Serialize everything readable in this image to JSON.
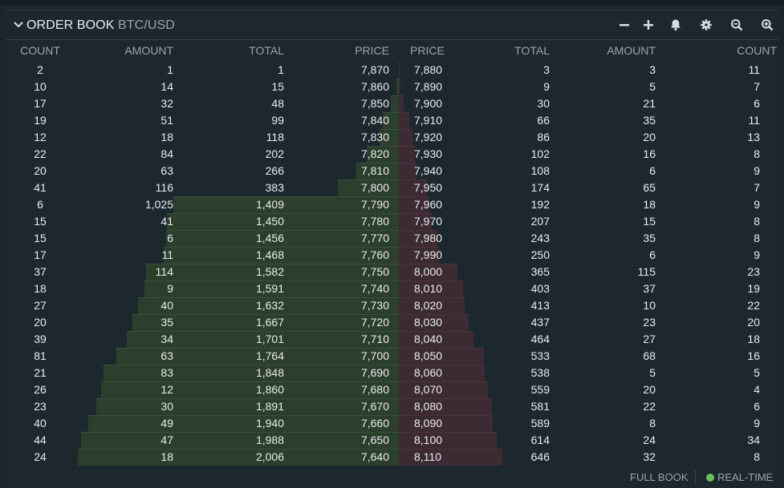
{
  "header": {
    "title": "ORDER BOOK",
    "pair": "BTC/USD",
    "icons": [
      "minus-icon",
      "plus-icon",
      "bell-icon",
      "gear-icon",
      "zoom-out-icon",
      "zoom-in-icon"
    ]
  },
  "columns": {
    "bid_count": "COUNT",
    "bid_amount": "AMOUNT",
    "bid_total": "TOTAL",
    "bid_price": "PRICE",
    "ask_price": "PRICE",
    "ask_total": "TOTAL",
    "ask_amount": "AMOUNT",
    "ask_count": "COUNT"
  },
  "colors": {
    "bid_bar": "#2c3f2c",
    "ask_bar": "#3d2b33",
    "realtime_dot": "#6bbf59"
  },
  "max_total": 2006,
  "bids": [
    {
      "count": "2",
      "amount": "1",
      "total": "1",
      "price": "7,870"
    },
    {
      "count": "10",
      "amount": "14",
      "total": "15",
      "price": "7,860"
    },
    {
      "count": "17",
      "amount": "32",
      "total": "48",
      "price": "7,850"
    },
    {
      "count": "19",
      "amount": "51",
      "total": "99",
      "price": "7,840"
    },
    {
      "count": "12",
      "amount": "18",
      "total": "118",
      "price": "7,830"
    },
    {
      "count": "22",
      "amount": "84",
      "total": "202",
      "price": "7,820"
    },
    {
      "count": "20",
      "amount": "63",
      "total": "266",
      "price": "7,810"
    },
    {
      "count": "41",
      "amount": "116",
      "total": "383",
      "price": "7,800"
    },
    {
      "count": "6",
      "amount": "1,025",
      "total": "1,409",
      "price": "7,790"
    },
    {
      "count": "15",
      "amount": "41",
      "total": "1,450",
      "price": "7,780"
    },
    {
      "count": "15",
      "amount": "6",
      "total": "1,456",
      "price": "7,770"
    },
    {
      "count": "17",
      "amount": "11",
      "total": "1,468",
      "price": "7,760"
    },
    {
      "count": "37",
      "amount": "114",
      "total": "1,582",
      "price": "7,750"
    },
    {
      "count": "18",
      "amount": "9",
      "total": "1,591",
      "price": "7,740"
    },
    {
      "count": "27",
      "amount": "40",
      "total": "1,632",
      "price": "7,730"
    },
    {
      "count": "20",
      "amount": "35",
      "total": "1,667",
      "price": "7,720"
    },
    {
      "count": "39",
      "amount": "34",
      "total": "1,701",
      "price": "7,710"
    },
    {
      "count": "81",
      "amount": "63",
      "total": "1,764",
      "price": "7,700"
    },
    {
      "count": "21",
      "amount": "83",
      "total": "1,848",
      "price": "7,690"
    },
    {
      "count": "26",
      "amount": "12",
      "total": "1,860",
      "price": "7,680"
    },
    {
      "count": "23",
      "amount": "30",
      "total": "1,891",
      "price": "7,670"
    },
    {
      "count": "40",
      "amount": "49",
      "total": "1,940",
      "price": "7,660"
    },
    {
      "count": "44",
      "amount": "47",
      "total": "1,988",
      "price": "7,650"
    },
    {
      "count": "24",
      "amount": "18",
      "total": "2,006",
      "price": "7,640"
    }
  ],
  "asks": [
    {
      "price": "7,880",
      "total": "3",
      "amount": "3",
      "count": "11"
    },
    {
      "price": "7,890",
      "total": "9",
      "amount": "5",
      "count": "7"
    },
    {
      "price": "7,900",
      "total": "30",
      "amount": "21",
      "count": "6"
    },
    {
      "price": "7,910",
      "total": "66",
      "amount": "35",
      "count": "11"
    },
    {
      "price": "7,920",
      "total": "86",
      "amount": "20",
      "count": "13"
    },
    {
      "price": "7,930",
      "total": "102",
      "amount": "16",
      "count": "8"
    },
    {
      "price": "7,940",
      "total": "108",
      "amount": "6",
      "count": "9"
    },
    {
      "price": "7,950",
      "total": "174",
      "amount": "65",
      "count": "7"
    },
    {
      "price": "7,960",
      "total": "192",
      "amount": "18",
      "count": "9"
    },
    {
      "price": "7,970",
      "total": "207",
      "amount": "15",
      "count": "8"
    },
    {
      "price": "7,980",
      "total": "243",
      "amount": "35",
      "count": "8"
    },
    {
      "price": "7,990",
      "total": "250",
      "amount": "6",
      "count": "9"
    },
    {
      "price": "8,000",
      "total": "365",
      "amount": "115",
      "count": "23"
    },
    {
      "price": "8,010",
      "total": "403",
      "amount": "37",
      "count": "19"
    },
    {
      "price": "8,020",
      "total": "413",
      "amount": "10",
      "count": "22"
    },
    {
      "price": "8,030",
      "total": "437",
      "amount": "23",
      "count": "20"
    },
    {
      "price": "8,040",
      "total": "464",
      "amount": "27",
      "count": "18"
    },
    {
      "price": "8,050",
      "total": "533",
      "amount": "68",
      "count": "16"
    },
    {
      "price": "8,060",
      "total": "538",
      "amount": "5",
      "count": "5"
    },
    {
      "price": "8,070",
      "total": "559",
      "amount": "20",
      "count": "4"
    },
    {
      "price": "8,080",
      "total": "581",
      "amount": "22",
      "count": "6"
    },
    {
      "price": "8,090",
      "total": "589",
      "amount": "8",
      "count": "9"
    },
    {
      "price": "8,100",
      "total": "614",
      "amount": "24",
      "count": "34"
    },
    {
      "price": "8,110",
      "total": "646",
      "amount": "32",
      "count": "8"
    }
  ],
  "footer": {
    "full_book": "FULL BOOK",
    "realtime": "REAL-TIME"
  }
}
